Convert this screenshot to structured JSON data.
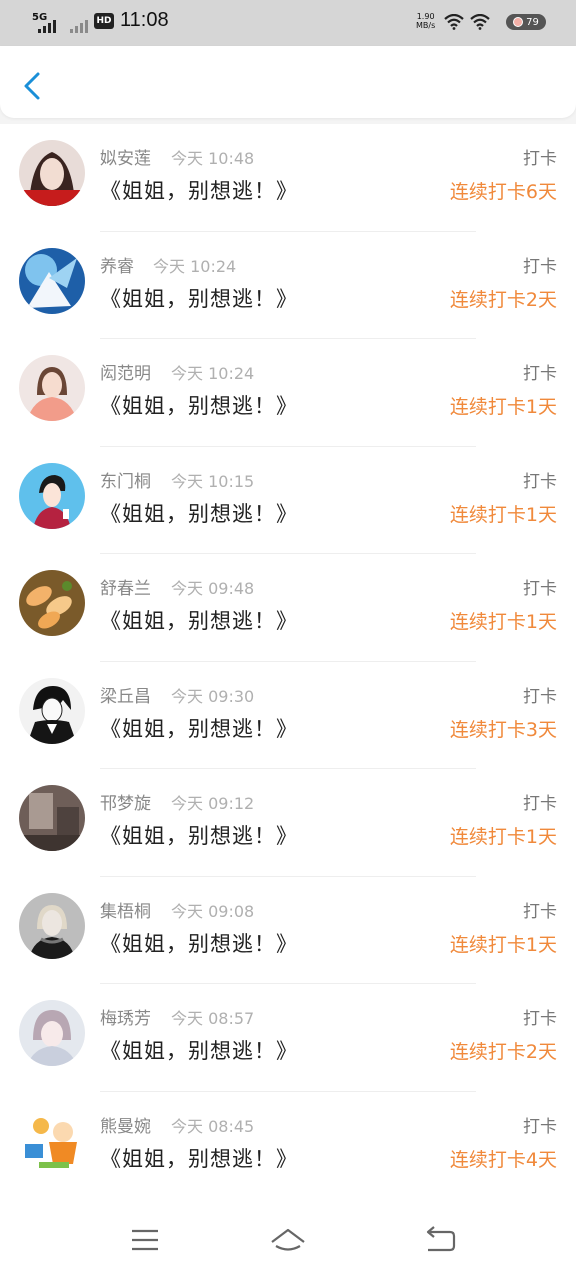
{
  "status_bar": {
    "network": "5G",
    "hd": "HD",
    "time": "11:08",
    "speed_value": "1.90",
    "speed_unit": "MB/s",
    "battery": "79"
  },
  "header": {
    "back_icon": "chevron-left-icon"
  },
  "feed": [
    {
      "name": "姒安莲",
      "time": "今天 10:48",
      "title": "《姐姐，别想逃！》",
      "kind": "打卡",
      "streak": "连续打卡6天"
    },
    {
      "name": "养睿",
      "time": "今天 10:24",
      "title": "《姐姐，别想逃！》",
      "kind": "打卡",
      "streak": "连续打卡2天"
    },
    {
      "name": "闳范明",
      "time": "今天 10:24",
      "title": "《姐姐，别想逃！》",
      "kind": "打卡",
      "streak": "连续打卡1天"
    },
    {
      "name": "东门桐",
      "time": "今天 10:15",
      "title": "《姐姐，别想逃！》",
      "kind": "打卡",
      "streak": "连续打卡1天"
    },
    {
      "name": "舒春兰",
      "time": "今天 09:48",
      "title": "《姐姐，别想逃！》",
      "kind": "打卡",
      "streak": "连续打卡1天"
    },
    {
      "name": "梁丘昌",
      "time": "今天 09:30",
      "title": "《姐姐，别想逃！》",
      "kind": "打卡",
      "streak": "连续打卡3天"
    },
    {
      "name": "邗梦旋",
      "time": "今天 09:12",
      "title": "《姐姐，别想逃！》",
      "kind": "打卡",
      "streak": "连续打卡1天"
    },
    {
      "name": "集梧桐",
      "time": "今天 09:08",
      "title": "《姐姐，别想逃！》",
      "kind": "打卡",
      "streak": "连续打卡1天"
    },
    {
      "name": "梅琇芳",
      "time": "今天 08:57",
      "title": "《姐姐，别想逃！》",
      "kind": "打卡",
      "streak": "连续打卡2天"
    },
    {
      "name": "熊曼婉",
      "time": "今天 08:45",
      "title": "《姐姐，别想逃！》",
      "kind": "打卡",
      "streak": "连续打卡4天"
    }
  ],
  "nav": {
    "menu_icon": "menu-icon",
    "home_icon": "home-icon",
    "back_icon": "back-icon"
  },
  "colors": {
    "accent": "#1a8fd8",
    "streak": "#f0893b"
  }
}
